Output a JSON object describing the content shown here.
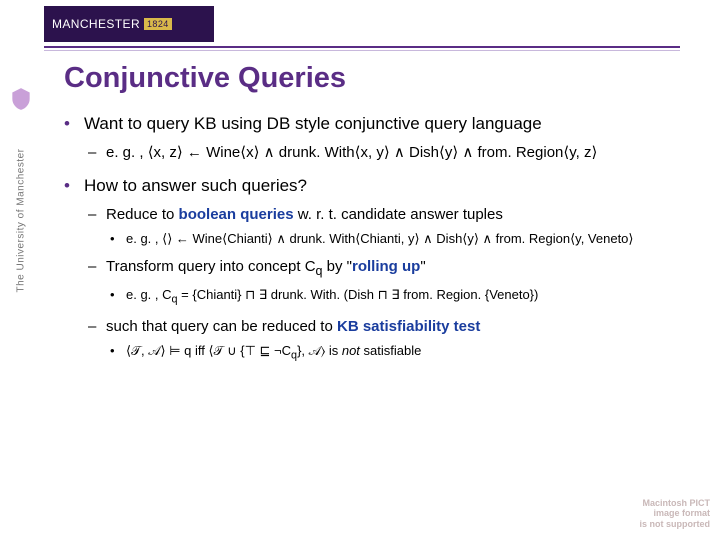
{
  "header": {
    "brand_main": "MANCHESTER",
    "brand_year": "1824",
    "sidebar_text": "The University of Manchester"
  },
  "title": "Conjunctive Queries",
  "bullets": {
    "b1": "Want to query KB using DB style conjunctive query language",
    "b1_eg_prefix": "e. g. , ",
    "b1_eg_body_html": "⟨x, z⟩ ← Wine⟨x⟩ ∧ drunk. With⟨x, y⟩ ∧ Dish⟨y⟩ ∧ from. Region⟨y, z⟩",
    "b2": "How to answer such queries?",
    "b2a_prefix": "Reduce to ",
    "b2a_bold": "boolean queries",
    "b2a_suffix": " w. r. t. candidate answer tuples",
    "b2a_eg_prefix": "e. g. , ",
    "b2a_eg_body_html": "⟨⟩ ← Wine⟨Chianti⟩ ∧ drunk. With⟨Chianti, y⟩ ∧ Dish⟨y⟩ ∧ from. Region⟨y, Veneto⟩",
    "b2b_prefix": "Transform query into concept C",
    "b2b_sub": "q",
    "b2b_mid": " by \"",
    "b2b_bold": "rolling up",
    "b2b_suffix": "\"",
    "b2b_eg_prefix": "e. g. , C",
    "b2b_eg_body_html": " = {Chianti} ⊓ ∃ drunk. With. (Dish ⊓ ∃ from. Region. {Veneto})",
    "b2c_prefix": "such that query can be reduced to ",
    "b2c_bold": "KB satisfiability test",
    "b2c_eg_prefix_html": "⟨𝒯, 𝒜⟩ ⊨ q iff ⟨𝒯 ∪ {⊤ ⊑ ¬C",
    "b2c_eg_suffix_html": "}, 𝒜⟩ is ",
    "b2c_eg_not": "not",
    "b2c_eg_tail": " satisfiable"
  },
  "footer": {
    "line1": "Macintosh PICT",
    "line2": "image format",
    "line3": "is not supported"
  }
}
